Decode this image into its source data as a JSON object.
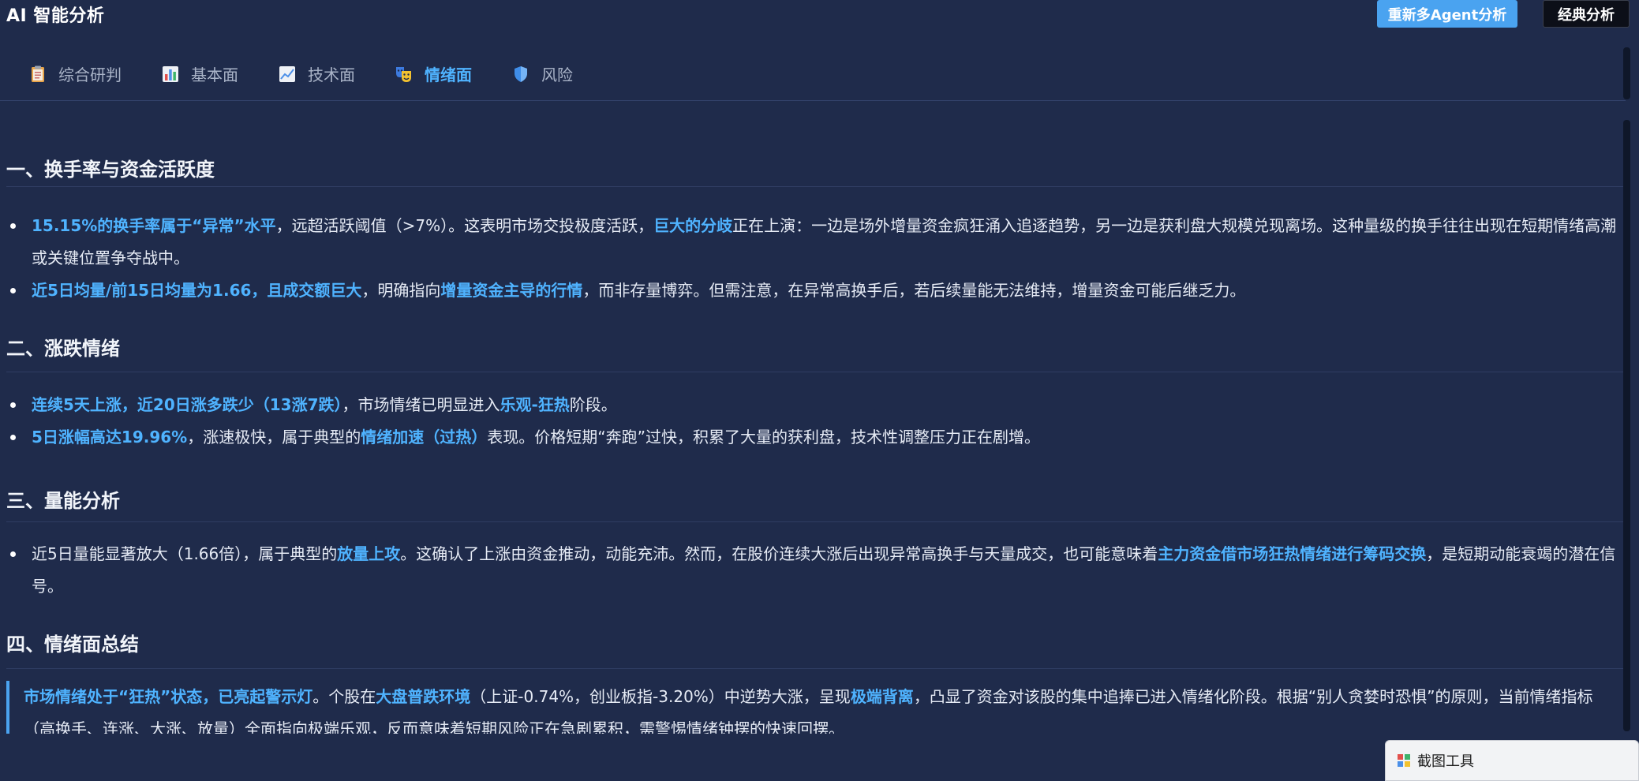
{
  "app": {
    "title": "AI 智能分析"
  },
  "toolbar": {
    "rerun_label": "重新多Agent分析",
    "classic_label": "经典分析"
  },
  "tabs": [
    {
      "label": "综合研判",
      "icon": "clipboard-icon",
      "active": false
    },
    {
      "label": "基本面",
      "icon": "bar-chart-icon",
      "active": false
    },
    {
      "label": "技术面",
      "icon": "line-chart-icon",
      "active": false
    },
    {
      "label": "情绪面",
      "icon": "masks-icon",
      "active": true
    },
    {
      "label": "风险",
      "icon": "shield-icon",
      "active": false
    }
  ],
  "sections": {
    "s1": {
      "title": "一、换手率与资金活跃度",
      "b1": {
        "hl1": "15.15%的换手率属于“异常”水平",
        "t1": "，远超活跃阈值（>7%）。这表明市场交投极度活跃，",
        "hl2": "巨大的分歧",
        "t2": "正在上演：一边是场外增量资金疯狂涌入追逐趋势，另一边是获利盘大规模兑现离场。这种量级的换手往往出现在短期情绪高潮或关键位置争夺战中。"
      },
      "b2": {
        "hl1": "近5日均量/前15日均量为1.66，且成交额巨大",
        "t1": "，明确指向",
        "hl2": "增量资金主导的行情",
        "t2": "，而非存量博弈。但需注意，在异常高换手后，若后续量能无法维持，增量资金可能后继乏力。"
      }
    },
    "s2": {
      "title": "二、涨跌情绪",
      "b1": {
        "hl1": "连续5天上涨，近20日涨多跌少（13涨7跌）",
        "t1": "，市场情绪已明显进入",
        "hl2": "乐观-狂热",
        "t2": "阶段。"
      },
      "b2": {
        "hl1": "5日涨幅高达19.96%",
        "t1": "，涨速极快，属于典型的",
        "hl2": "情绪加速（过热）",
        "t2": "表现。价格短期“奔跑”过快，积累了大量的获利盘，技术性调整压力正在剧增。"
      }
    },
    "s3": {
      "title": "三、量能分析",
      "b1": {
        "t0": "近5日量能显著放大（1.66倍），属于典型的",
        "hl1": "放量上攻",
        "t1": "。这确认了上涨由资金推动，动能充沛。然而，在股价连续大涨后出现异常高换手与天量成交，也可能意味着",
        "hl2": "主力资金借市场狂热情绪进行筹码交换",
        "t2": "，是短期动能衰竭的潜在信号。"
      }
    },
    "s4": {
      "title": "四、情绪面总结",
      "summary": {
        "hl1": "市场情绪处于“狂热”状态，已亮起警示灯",
        "t1": "。个股在",
        "hl2": "大盘普跌环境",
        "t2": "（上证-0.74%，创业板指-3.20%）中逆势大涨，呈现",
        "hl3": "极端背离",
        "t3": "，凸显了资金对该股的集中追捧已进入情绪化阶段。根据“别人贪婪时恐惧”的原则，当前情绪指标（高换手、连涨、大涨、放量）全面指向极端乐观，反而意味着短期风险正在急剧累积，需警惕情绪钟摆的快速回摆。"
      }
    }
  },
  "screenshot_tool": {
    "label": "截图工具"
  }
}
